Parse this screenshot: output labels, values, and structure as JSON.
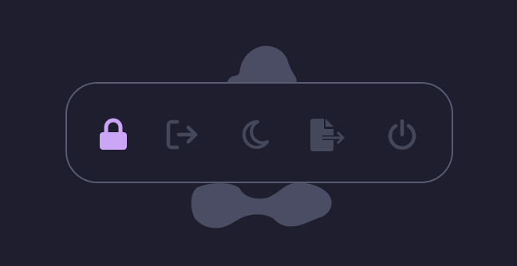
{
  "colors": {
    "background": "#1e1e2e",
    "menu_border": "#585b70",
    "icon_inactive": "#45475a",
    "icon_active": "#cba6f7",
    "wallpaper_shape": "#45475a"
  },
  "power_menu": {
    "buttons": [
      {
        "id": "lock",
        "icon": "lock-icon",
        "selected": true
      },
      {
        "id": "logout",
        "icon": "logout-icon",
        "selected": false
      },
      {
        "id": "suspend",
        "icon": "moon-icon",
        "selected": false
      },
      {
        "id": "hibernate",
        "icon": "file-export-icon",
        "selected": false
      },
      {
        "id": "shutdown",
        "icon": "power-icon",
        "selected": false
      }
    ]
  }
}
